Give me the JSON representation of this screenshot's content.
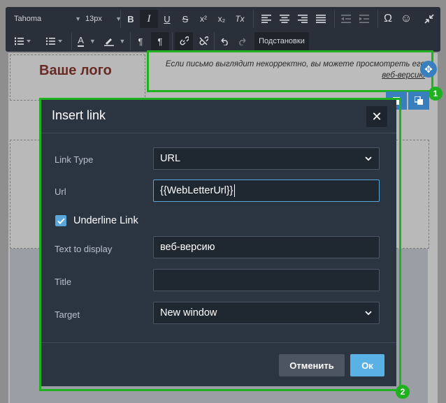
{
  "toolbar": {
    "font_family": "Tahoma",
    "font_size": "13px",
    "buttons": {
      "bold": "B",
      "italic": "I",
      "underline": "U",
      "strike": "S",
      "superscript": "x²",
      "subscript": "x₂",
      "clear_format": "Tx",
      "special_char": "Ω",
      "emoji": "☺",
      "text_color": "A",
      "ltr": "¶",
      "rtl": "¶",
      "substitutions": "Подстановки"
    }
  },
  "editor": {
    "logo_text": "Ваше лого",
    "header_text": "Если письмо выглядит некорректно, вы можете просмотреть его",
    "header_link": "веб-версию"
  },
  "dialog": {
    "title": "Insert link",
    "close_glyph": "✕",
    "fields": {
      "link_type_label": "Link Type",
      "link_type_value": "URL",
      "url_label": "Url",
      "url_value": "{{WebLetterUrl}}",
      "underline_label": "Underline Link",
      "underline_checked": true,
      "text_label": "Text to display",
      "text_value": "веб-версию",
      "title_label": "Title",
      "title_value": "",
      "target_label": "Target",
      "target_value": "New window"
    },
    "buttons": {
      "cancel": "Отменить",
      "ok": "Ок"
    }
  },
  "annotations": {
    "badge_1": "1",
    "badge_2": "2",
    "highlight_color": "#1fb11f"
  },
  "colors": {
    "dialog_bg": "#2b3542",
    "accent": "#59b1e6",
    "toolbar_bg": "#2a3039"
  }
}
